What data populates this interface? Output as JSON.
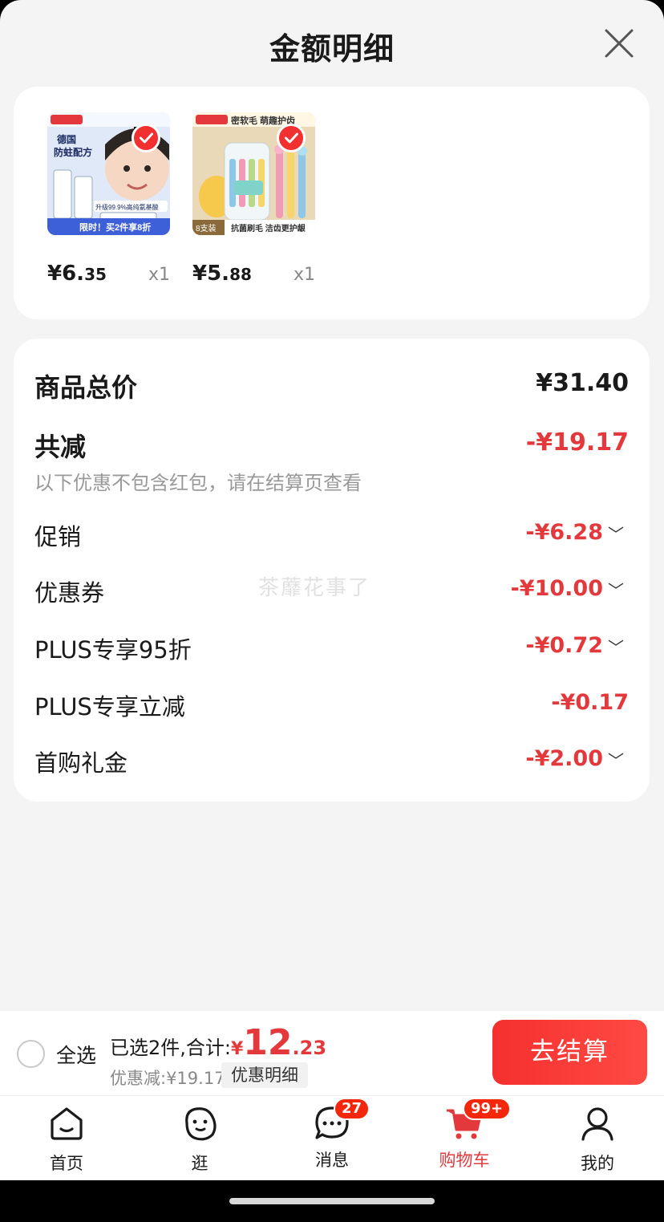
{
  "header": {
    "title": "金额明细"
  },
  "products": [
    {
      "image_texts": [
        "德国",
        "防蛀配方",
        "升级99.9%高纯氨基酸",
        "限时！买2件享8折"
      ],
      "price_int": "¥6.",
      "price_dec": "35",
      "qty": "x1"
    },
    {
      "image_texts": [
        "密软毛 萌趣护齿",
        "8支装",
        "抗菌刷毛 洁齿更护龈"
      ],
      "price_int": "¥5.",
      "price_dec": "88",
      "qty": "x1"
    }
  ],
  "summary": {
    "total_label": "商品总价",
    "total_value": "¥31.40",
    "reduce_label": "共减",
    "reduce_value": "-¥19.17",
    "reduce_note": "以下优惠不包含红包，请在结算页查看",
    "items": [
      {
        "label": "促销",
        "value": "-¥6.28",
        "expand": true
      },
      {
        "label": "优惠券",
        "value": "-¥10.00",
        "expand": true
      },
      {
        "label": "PLUS专享95折",
        "value": "-¥0.72",
        "expand": true
      },
      {
        "label": "PLUS专享立减",
        "value": "-¥0.17",
        "expand": false
      },
      {
        "label": "首购礼金",
        "value": "-¥2.00",
        "expand": true
      }
    ]
  },
  "watermark": "茶蘼花事了",
  "checkout": {
    "select_all": "全选",
    "selected_text": "已选2件,合计:",
    "currency": "¥",
    "total_int": "12",
    "total_dec": ".23",
    "discount_text": "优惠减:¥19.17",
    "detail_chip": "优惠明细",
    "button": "去结算"
  },
  "tabbar": {
    "items": [
      {
        "label": "首页",
        "icon": "home-icon"
      },
      {
        "label": "逛",
        "icon": "explore-icon"
      },
      {
        "label": "消息",
        "icon": "message-icon",
        "badge": "27"
      },
      {
        "label": "购物车",
        "icon": "cart-icon",
        "badge": "99+",
        "active": true
      },
      {
        "label": "我的",
        "icon": "profile-icon"
      }
    ]
  },
  "colors": {
    "accent": "#e4393c",
    "button": "#f5302e",
    "background": "#f4f4f4"
  }
}
